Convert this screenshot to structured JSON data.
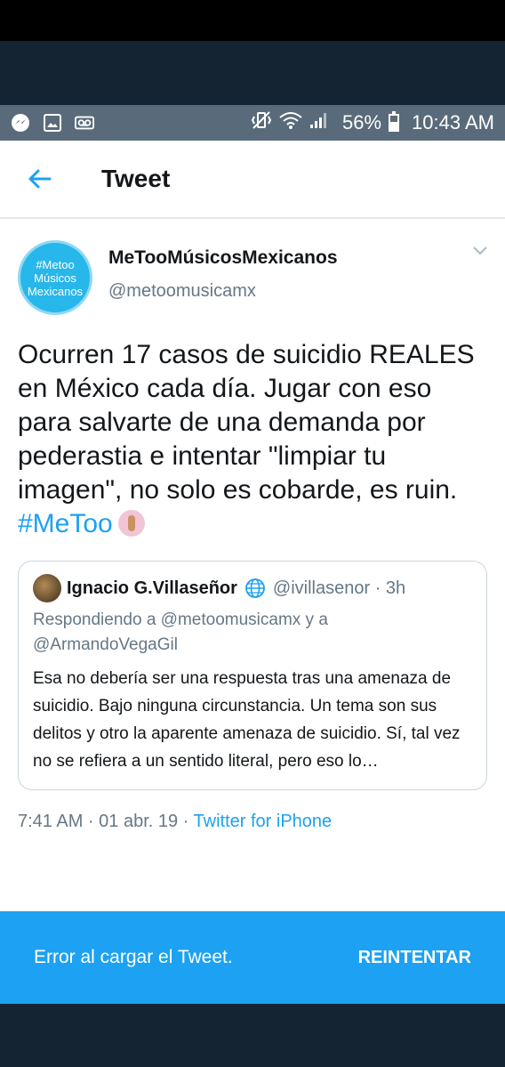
{
  "status_bar": {
    "battery": "56%",
    "time": "10:43 AM",
    "left_icons": [
      "messenger-icon",
      "gallery-icon",
      "voicemail-icon"
    ],
    "right_icons": [
      "vibrate-icon",
      "wifi-icon",
      "signal-icon",
      "battery-icon"
    ]
  },
  "appbar": {
    "title": "Tweet",
    "back_icon": "arrow-left-icon"
  },
  "tweet": {
    "avatar_text": [
      "#Metoo",
      "Músicos",
      "Mexicanos"
    ],
    "display_name": "MeTooMúsicosMexicanos",
    "handle": "@metoomusicamx",
    "text": "Ocurren 17 casos de suicidio REALES en México cada día. Jugar con eso para salvarte de una demanda por pederastia e intentar \"limpiar tu imagen\", no solo es cobarde, es ruin.",
    "hashtag": "#MeToo",
    "timestamp": "7:41 AM · 01 abr. 19 · ",
    "source": "Twitter for iPhone"
  },
  "quote": {
    "name": "Ignacio G.Villaseñor",
    "handle_time": "@ivillasenor · 3h",
    "reply_to": "Respondiendo a @metoomusicamx y a @ArmandoVegaGil",
    "text": "Esa no debería ser una respuesta tras una amenaza de suicidio. Bajo ninguna circunstancia. Un tema son sus delitos y otro la aparente amenaza de suicidio. Sí, tal vez no se refiera a un sentido literal, pero eso lo…"
  },
  "snackbar": {
    "message": "Error al cargar el Tweet.",
    "action": "REINTENTAR"
  },
  "colors": {
    "accent": "#1da1f2",
    "status_bar": "#596b7a",
    "avatar": "#27b7ea"
  }
}
